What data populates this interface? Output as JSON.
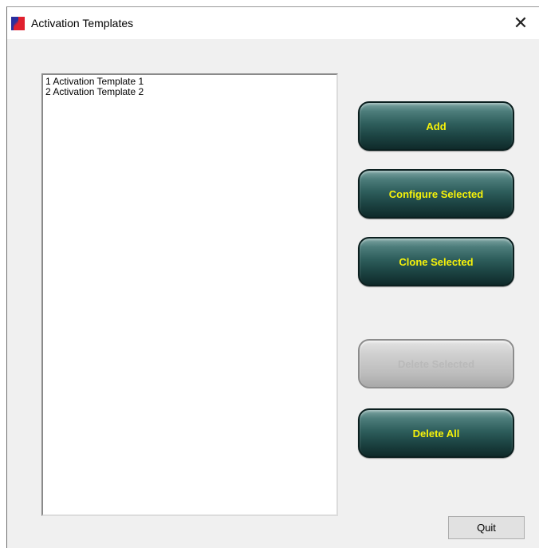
{
  "window": {
    "title": "Activation Templates",
    "close_glyph": "✕",
    "icon": "app-icon"
  },
  "templates": {
    "items": [
      "1 Activation Template 1",
      "2 Activation Template 2"
    ]
  },
  "actions": {
    "add_label": "Add",
    "configure_label": "Configure Selected",
    "clone_label": "Clone Selected",
    "delete_selected_label": "Delete Selected",
    "delete_selected_enabled": false,
    "delete_all_label": "Delete All"
  },
  "footer": {
    "quit_label": "Quit"
  },
  "colors": {
    "button_text": "#f6f20a",
    "button_face": "#2e5e5c",
    "disabled_face": "#c4c4c4",
    "disabled_text": "#b9b9b9"
  }
}
